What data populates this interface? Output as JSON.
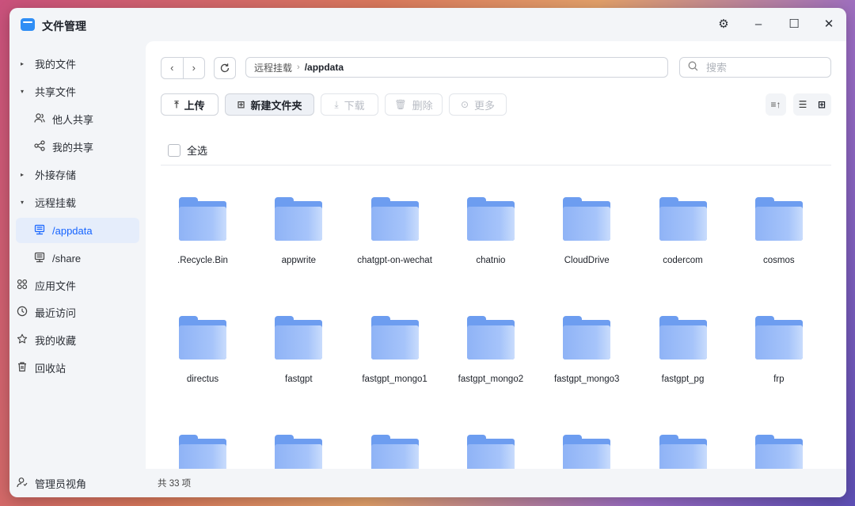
{
  "window": {
    "title": "文件管理",
    "controls": {
      "settings": "⚙",
      "minimize": "–",
      "maximize": "☐",
      "close": "✕"
    }
  },
  "sidebar": {
    "items": [
      {
        "label": "我的文件",
        "icon": "caret-right-icon"
      },
      {
        "label": "共享文件",
        "icon": "caret-down-icon"
      },
      {
        "label": "他人共享",
        "icon": "people-icon"
      },
      {
        "label": "我的共享",
        "icon": "share-icon"
      },
      {
        "label": "外接存储",
        "icon": "caret-right-icon"
      },
      {
        "label": "远程挂载",
        "icon": "caret-down-icon"
      },
      {
        "label": "/appdata",
        "icon": "server-icon",
        "active": true
      },
      {
        "label": "/share",
        "icon": "server-icon"
      },
      {
        "label": "应用文件",
        "icon": "apps-icon"
      },
      {
        "label": "最近访问",
        "icon": "clock-icon"
      },
      {
        "label": "我的收藏",
        "icon": "star-icon"
      },
      {
        "label": "回收站",
        "icon": "trash-icon"
      }
    ],
    "admin_view": "管理员视角"
  },
  "toolbar": {
    "breadcrumb": [
      "远程挂载",
      "/appdata"
    ],
    "search_placeholder": "搜索",
    "upload": "上传",
    "new_folder": "新建文件夹",
    "download": "下载",
    "delete": "删除",
    "more": "更多",
    "select_all": "全选"
  },
  "files": [
    ".Recycle.Bin",
    "appwrite",
    "chatgpt-on-wechat",
    "chatnio",
    "CloudDrive",
    "codercom",
    "cosmos",
    "directus",
    "fastgpt",
    "fastgpt_mongo1",
    "fastgpt_mongo2",
    "fastgpt_mongo3",
    "fastgpt_pg",
    "frp",
    "",
    "",
    "",
    "",
    "",
    "",
    ""
  ],
  "status": {
    "count_text": "共 33 项"
  },
  "colors": {
    "accent": "#1664ff",
    "folder": "#6d9df0"
  }
}
